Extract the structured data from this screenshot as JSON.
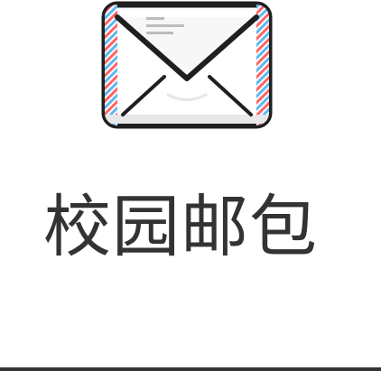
{
  "app": {
    "title": "校园邮包",
    "icon": "envelope-icon"
  },
  "colors": {
    "outline": "#1f1f1f",
    "envelope_fill": "#ffffff",
    "envelope_shadow": "#e8e8e8",
    "airmail_red": "#ff6464",
    "airmail_blue": "#5cb8f0",
    "letter_lines": "#bcbcbc",
    "title_text": "#333333",
    "bottom_rule": "#333333"
  }
}
